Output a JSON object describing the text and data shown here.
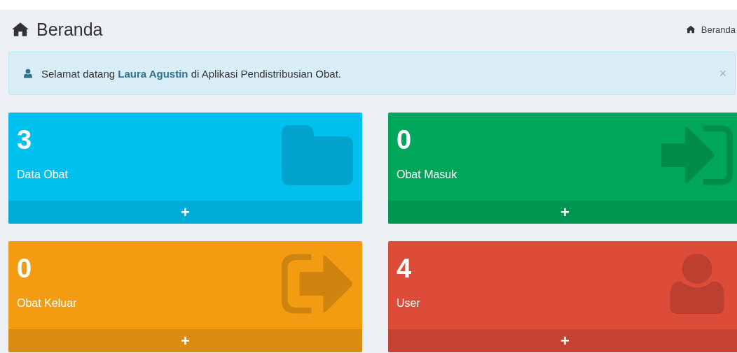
{
  "header": {
    "title": "Beranda",
    "breadcrumb": "Beranda"
  },
  "alert": {
    "text": "Selamat datang **Laura Agustin** di Aplikasi Pendistribusian Obat.",
    "close": "×"
  },
  "boxes": [
    {
      "count": "3",
      "label": "Data Obat",
      "kind": "folder",
      "color": "#00c0ef",
      "more": "+"
    },
    {
      "count": "0",
      "label": "Obat Masuk",
      "kind": "entry",
      "color": "#00a65a",
      "more": "+"
    },
    {
      "count": "0",
      "label": "Obat Keluar",
      "kind": "exit",
      "color": "#f39c12",
      "more": "+"
    },
    {
      "count": "4",
      "label": "User",
      "kind": "person",
      "color": "#dd4b39",
      "more": "+"
    }
  ]
}
